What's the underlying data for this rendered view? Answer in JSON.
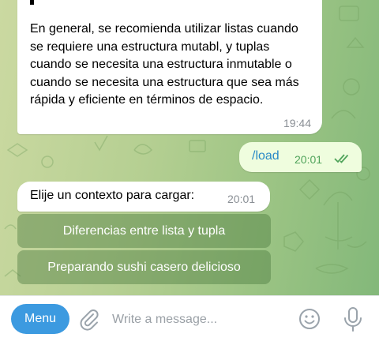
{
  "messages": {
    "long_reply": {
      "text": "En general, se recomienda utilizar listas cuando se requiere una estructura mutabl, y tuplas cuando se necesita una estructura inmutable o cuando se necesita una estructura que sea más rápida y eficiente en términos de espacio.",
      "time": "19:44"
    },
    "outgoing": {
      "text": "/load",
      "time": "20:01",
      "status_icon": "double-check-icon"
    },
    "context_prompt": {
      "text": "Elije un contexto para cargar:",
      "time": "20:01"
    }
  },
  "keyboard": {
    "buttons": [
      {
        "label": "Diferencias entre lista y tupla"
      },
      {
        "label": "Preparando sushi casero delicioso"
      }
    ]
  },
  "composer": {
    "menu_label": "Menu",
    "placeholder": "Write a message...",
    "icons": [
      "paperclip-icon",
      "emoji-icon",
      "microphone-icon"
    ]
  },
  "colors": {
    "outgoing_bubble": "#effdde",
    "menu_button": "#3c9ae0",
    "read_check": "#4fa35a"
  }
}
